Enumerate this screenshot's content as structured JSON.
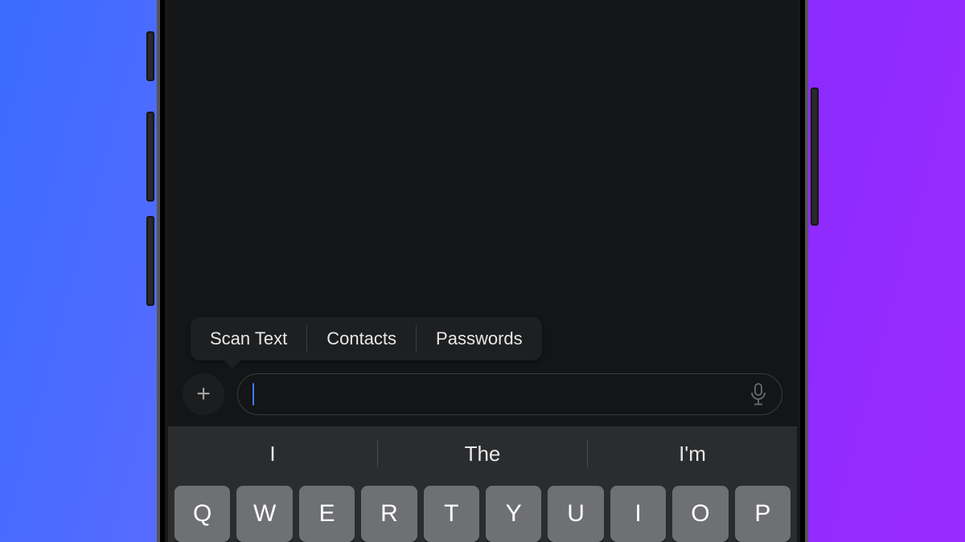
{
  "popover": {
    "items": [
      "Scan Text",
      "Contacts",
      "Passwords"
    ]
  },
  "input": {
    "value": "",
    "placeholder": ""
  },
  "icons": {
    "plus": "+",
    "mic": "mic"
  },
  "keyboard": {
    "suggestions": [
      "I",
      "The",
      "I'm"
    ],
    "row1": [
      "Q",
      "W",
      "E",
      "R",
      "T",
      "Y",
      "U",
      "I",
      "O",
      "P"
    ]
  },
  "colors": {
    "accent": "#3a7dff",
    "bg_dark": "#141517",
    "key": "#6f7073",
    "keyboard": "#2b2c2e"
  }
}
